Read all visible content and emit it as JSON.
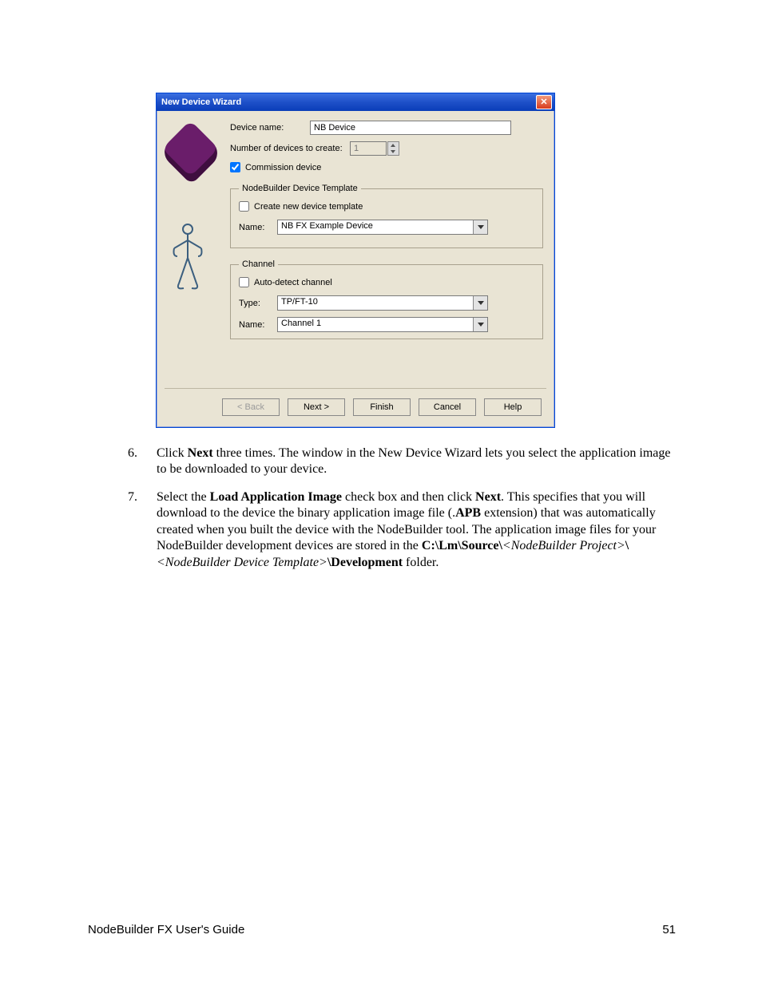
{
  "dialog": {
    "title": "New Device Wizard",
    "device_name_label": "Device name:",
    "device_name_value": "NB Device",
    "num_devices_label": "Number of devices to create:",
    "num_devices_value": "1",
    "commission_label": "Commission device",
    "template_legend": "NodeBuilder Device Template",
    "create_template_label": "Create new device template",
    "template_name_label": "Name:",
    "template_name_value": "NB FX Example Device",
    "channel_legend": "Channel",
    "autodetect_label": "Auto-detect channel",
    "type_label": "Type:",
    "type_value": "TP/FT-10",
    "channel_name_label": "Name:",
    "channel_name_value": "Channel 1",
    "buttons": {
      "back": "< Back",
      "next": "Next >",
      "finish": "Finish",
      "cancel": "Cancel",
      "help": "Help"
    }
  },
  "doc": {
    "step6_num": "6.",
    "step6_a": "Click ",
    "step6_b": "Next",
    "step6_c": " three times.  The window in the New Device Wizard lets you select the application image to be downloaded to your device.",
    "step7_num": "7.",
    "step7_a": "Select the ",
    "step7_b": "Load Application Image",
    "step7_c": " check box and then click ",
    "step7_d": "Next",
    "step7_e": ".  This specifies that you will download to the device the binary application image file (.",
    "step7_f": "APB",
    "step7_g": " extension) that was automatically created when you built the device with the NodeBuilder tool.  The application image files for your NodeBuilder development devices are stored in the ",
    "step7_h": "C:\\Lm\\Source\\",
    "step7_i": "<NodeBuilder Project>",
    "step7_j": "\\",
    "step7_k": "<NodeBuilder Device Template>",
    "step7_l": "\\Development",
    "step7_m": " folder.",
    "footer_left": "NodeBuilder FX User's Guide",
    "footer_right": "51"
  }
}
